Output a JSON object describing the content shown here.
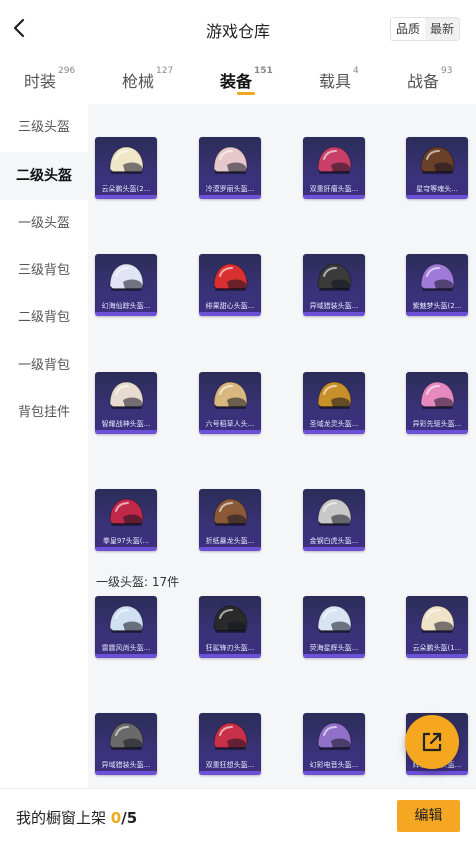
{
  "header": {
    "title": "游戏仓库",
    "sort_options": [
      "品质",
      "最新"
    ]
  },
  "tabs": [
    {
      "label": "时装",
      "count": "296"
    },
    {
      "label": "枪械",
      "count": "127"
    },
    {
      "label": "装备",
      "count": "151"
    },
    {
      "label": "载具",
      "count": "4"
    },
    {
      "label": "战备",
      "count": "93"
    }
  ],
  "sidebar": {
    "items": [
      "三级头盔",
      "二级头盔",
      "一级头盔",
      "三级背包",
      "二级背包",
      "一级背包",
      "背包挂件"
    ]
  },
  "sections": {
    "helmet2_items": [
      {
        "name": "云朵鹏头盔(2...",
        "icon": "helmet-cloud-bird-icon",
        "color": "#f0e6c8"
      },
      {
        "name": "冷漠罗丽头盔...",
        "icon": "helmet-pink-floral-icon",
        "color": "#e6c8cc"
      },
      {
        "name": "双重肝瘤头盔...",
        "icon": "helmet-pink-rockstar-icon",
        "color": "#c84068"
      },
      {
        "name": "星穹等魂头...",
        "icon": "helmet-dark-crest-icon",
        "color": "#6a4028"
      },
      {
        "name": "幻海仙踪头盔...",
        "icon": "helmet-crystal-wing-icon",
        "color": "#e0e4f4"
      },
      {
        "name": "绯果甜心头盔...",
        "icon": "helmet-strawberry-icon",
        "color": "#d83030"
      },
      {
        "name": "异域猎装头盔...",
        "icon": "helmet-dark-visor-icon",
        "color": "#3a3a3a"
      },
      {
        "name": "紫魅梦头盔(2...",
        "icon": "helmet-purple-dream-icon",
        "color": "#a07ad8"
      },
      {
        "name": "智耀战神头盔...",
        "icon": "helmet-gold-ornate-icon",
        "color": "#e8dcd0"
      },
      {
        "name": "六号稻草人头...",
        "icon": "helmet-scarecrow-icon",
        "color": "#d8b880"
      },
      {
        "name": "圣域龙灵头盔...",
        "icon": "helmet-golden-dragon-icon",
        "color": "#c8902a"
      },
      {
        "name": "异彩先驱头盔...",
        "icon": "helmet-pink-fish-icon",
        "color": "#e888c0"
      },
      {
        "name": "拳皇97头盔(...",
        "icon": "helmet-kof97-icon",
        "color": "#c02848"
      },
      {
        "name": "折纸暴龙头盔...",
        "icon": "helmet-origami-rex-icon",
        "color": "#8a5a38"
      },
      {
        "name": "金钢白虎头盔...",
        "icon": "helmet-white-tiger-icon",
        "color": "#c8c8c8"
      }
    ],
    "helmet1_header": "一级头盔: 17件",
    "helmet1_items": [
      {
        "name": "雷霆风尚头盔...",
        "icon": "helmet-blue-pearl-icon",
        "color": "#cfe0f2"
      },
      {
        "name": "狂鲨锋刃头盔...",
        "icon": "helmet-black-moto-icon",
        "color": "#2a2a2a"
      },
      {
        "name": "荧海星辉头盔...",
        "icon": "helmet-galaxy-icon",
        "color": "#d8e4f4"
      },
      {
        "name": "云朵鹏头盔(1...",
        "icon": "helmet-cream-gold-icon",
        "color": "#f0e4c8"
      },
      {
        "name": "异域猎装头盔...",
        "icon": "helmet-grey-visor-icon",
        "color": "#6a6a6a"
      },
      {
        "name": "双重狂想头盔...",
        "icon": "helmet-red-blue-icon",
        "color": "#c83048"
      },
      {
        "name": "幻彩电音头盔...",
        "icon": "helmet-purple-flower-icon",
        "color": "#9070c8"
      },
      {
        "name": "辉羽圣灵头盔...",
        "icon": "helmet-gold-white-icon",
        "color": "#e8d090"
      }
    ]
  },
  "bottom_bar": {
    "label": "我的橱窗上架",
    "count": "0",
    "max": "/5",
    "edit_label": "编辑"
  },
  "colors": {
    "accent": "#f5a623",
    "card_background": "#2f2c66",
    "card_rarity_bar": "#6c50d8",
    "content_background": "#f5f6f8"
  }
}
